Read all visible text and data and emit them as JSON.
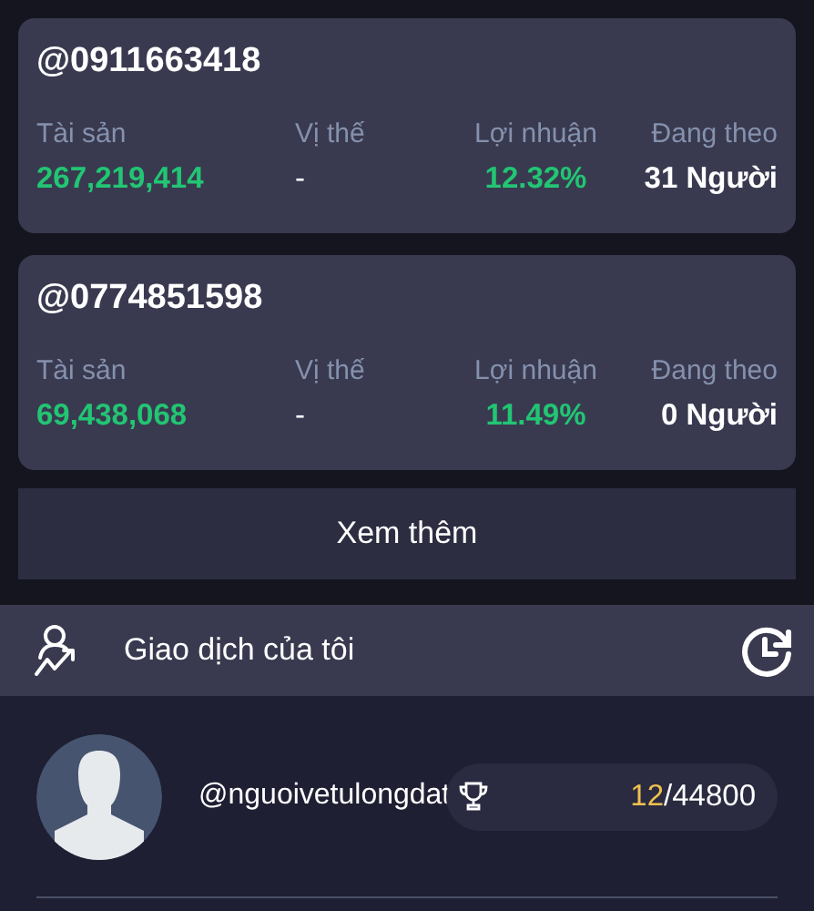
{
  "traders": [
    {
      "handle": "@0911663418",
      "stats": [
        {
          "label": "Tài sản",
          "value": "267,219,414",
          "kind": "positive"
        },
        {
          "label": "Vị thế",
          "value": "-",
          "kind": "plain"
        },
        {
          "label": "Lợi nhuận",
          "value": "12.32%",
          "kind": "positive"
        },
        {
          "label": "Đang theo",
          "value": "31 Người",
          "kind": "bold"
        }
      ]
    },
    {
      "handle": "@0774851598",
      "stats": [
        {
          "label": "Tài sản",
          "value": "69,438,068",
          "kind": "positive"
        },
        {
          "label": "Vị thế",
          "value": "-",
          "kind": "plain"
        },
        {
          "label": "Lợi nhuận",
          "value": "11.49%",
          "kind": "positive"
        },
        {
          "label": "Đang theo",
          "value": "0 Người",
          "kind": "bold"
        }
      ]
    }
  ],
  "more_button": "Xem thêm",
  "my_trades": {
    "title": "Giao dịch của tôi"
  },
  "profile": {
    "handle": "@nguoivetulongdat",
    "rank": "12",
    "total": "/44800"
  }
}
